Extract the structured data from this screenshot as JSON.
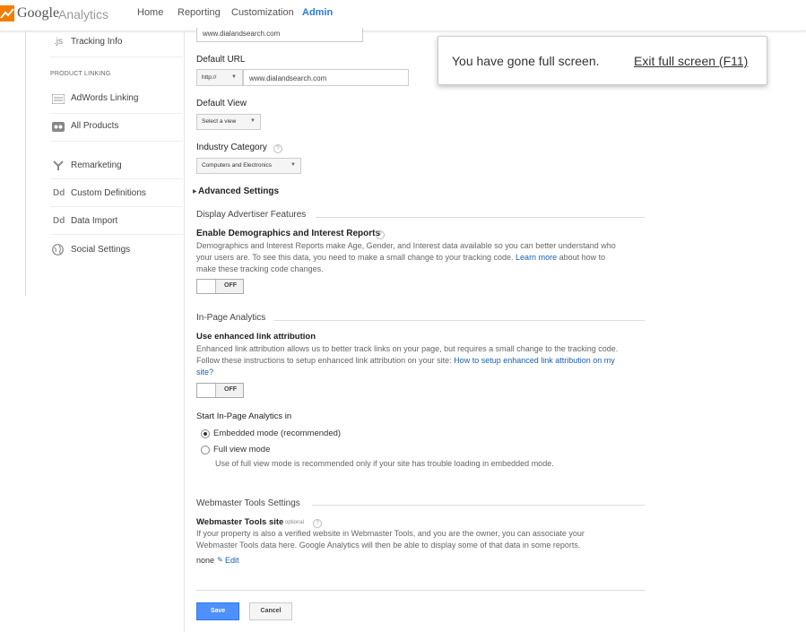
{
  "header": {
    "logo_google": "Google",
    "logo_analytics": "Analytics",
    "tabs": [
      "Home",
      "Reporting",
      "Customization",
      "Admin"
    ],
    "accent": "#2a7cd6"
  },
  "sidebar": {
    "tracking_info": "Tracking Info",
    "tracking_icon": ".js",
    "heading": "PRODUCT LINKING",
    "items": [
      {
        "label": "AdWords Linking",
        "icon": "adwords-icon"
      },
      {
        "label": "All Products",
        "icon": "link-icon"
      },
      {
        "label": "Remarketing",
        "icon": "remarketing-icon"
      },
      {
        "label": "Custom Definitions",
        "icon": "Dd"
      },
      {
        "label": "Data Import",
        "icon": "Dd"
      },
      {
        "label": "Social Settings",
        "icon": "globe-icon"
      }
    ]
  },
  "form": {
    "website_url_value": "www.dialandsearch.com",
    "default_url_label": "Default URL",
    "protocol_value": "http://",
    "default_url_value": "www.dialandsearch.com",
    "default_view_label": "Default View",
    "default_view_value": "Select a view",
    "industry_label": "Industry Category",
    "industry_value": "Computers and Electronics",
    "advanced_settings": "Advanced Settings",
    "display_adv_title": "Display Advertiser Features",
    "demographics_title": "Enable Demographics and Interest Reports",
    "demographics_desc_1": "Demographics and Interest Reports make Age, Gender, and Interest data available so you can better understand who",
    "demographics_desc_2a": "your users are. To see this data, you need to make a small change to your tracking code.",
    "demographics_learn_more": "Learn more",
    "demographics_desc_2b": "about how to",
    "demographics_desc_3": "make these tracking code changes.",
    "demographics_toggle": "OFF",
    "inpage_title": "In-Page Analytics",
    "enhanced_title": "Use enhanced link attribution",
    "enhanced_desc_1": "Enhanced link attribution allows us to better track links on your page, but requires a small change to the tracking code.",
    "enhanced_desc_2a": "Follow these instructions to setup enhanced link attribution on your site:",
    "enhanced_link_a": "How to setup enhanced link attribution on my",
    "enhanced_link_b": "site?",
    "enhanced_toggle": "OFF",
    "start_inpage_label": "Start In-Page Analytics in",
    "radio_embedded": "Embedded mode (recommended)",
    "radio_full": "Full view mode",
    "full_view_note": "Use of full view mode is recommended only if your site has trouble loading in embedded mode.",
    "webmaster_section": "Webmaster Tools Settings",
    "webmaster_label": "Webmaster Tools site",
    "webmaster_optional": "optional",
    "webmaster_desc_1": "If your property is also a verified website in Webmaster Tools, and you are the owner, you can associate your",
    "webmaster_desc_2": "Webmaster Tools data here. Google Analytics will then be able to display some of that data in some reports.",
    "webmaster_value": "none",
    "webmaster_edit": "Edit",
    "save": "Save",
    "cancel": "Cancel",
    "help_glyph": "?"
  },
  "fullscreen": {
    "message": "You have gone full screen.",
    "exit": "Exit full screen (F11)"
  }
}
